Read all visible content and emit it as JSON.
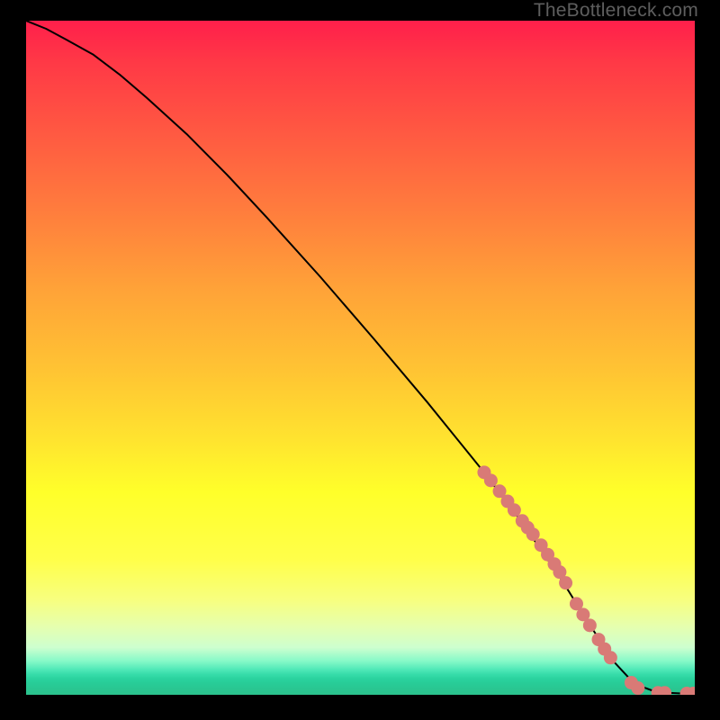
{
  "attribution": "TheBottleneck.com",
  "chart_data": {
    "type": "line",
    "title": "",
    "xlabel": "",
    "ylabel": "",
    "xlim": [
      0,
      100
    ],
    "ylim": [
      0,
      100
    ],
    "curve": {
      "name": "curve",
      "x": [
        0,
        3,
        6,
        10,
        14,
        18,
        24,
        30,
        36,
        44,
        52,
        60,
        68,
        74,
        80,
        84,
        88,
        91,
        94,
        96,
        98,
        100
      ],
      "y": [
        100,
        98.8,
        97.2,
        95.0,
        92.0,
        88.6,
        83.2,
        77.2,
        70.8,
        62.0,
        52.8,
        43.4,
        33.6,
        25.8,
        17.2,
        10.8,
        4.8,
        1.6,
        0.5,
        0.3,
        0.2,
        0.2
      ]
    },
    "points": {
      "name": "markers",
      "color": "#d97a76",
      "x": [
        68.5,
        69.5,
        70.8,
        72.0,
        73.0,
        74.2,
        75.0,
        75.8,
        77.0,
        78.0,
        79.0,
        79.8,
        80.7,
        82.3,
        83.3,
        84.3,
        85.6,
        86.5,
        87.4,
        90.5,
        91.5,
        94.5,
        95.5,
        98.8,
        99.8
      ],
      "y": [
        33.0,
        31.8,
        30.2,
        28.7,
        27.4,
        25.8,
        24.8,
        23.8,
        22.2,
        20.8,
        19.4,
        18.2,
        16.6,
        13.5,
        11.9,
        10.3,
        8.2,
        6.8,
        5.5,
        1.8,
        1.0,
        0.3,
        0.3,
        0.2,
        0.2
      ]
    }
  }
}
